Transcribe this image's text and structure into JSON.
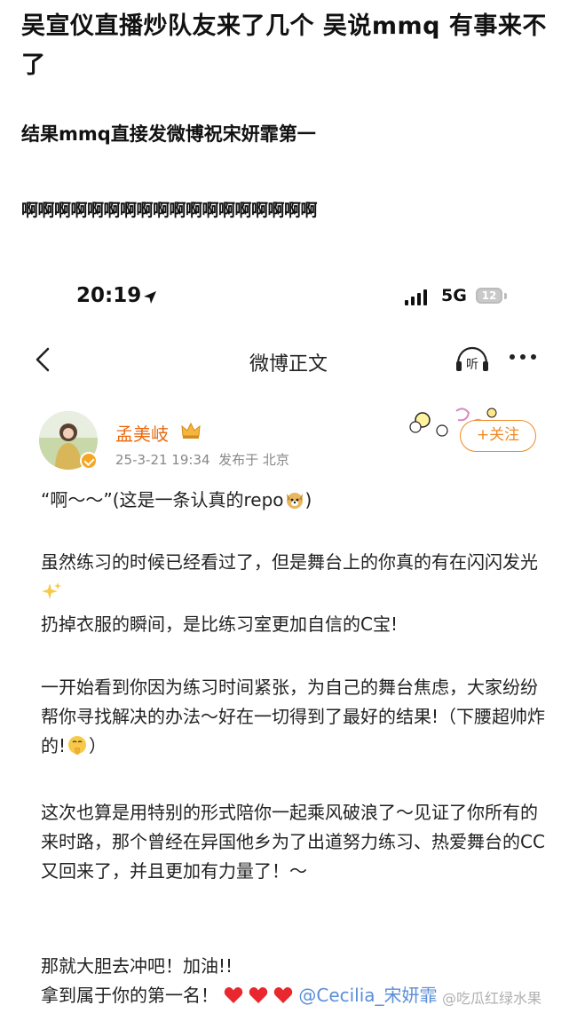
{
  "caption": {
    "title": "吴宣仪直播炒队友来了几个 吴说mmq 有事来不了",
    "line2": "结果mmq直接发微博祝宋妍霏第一",
    "line3": "啊啊啊啊啊啊啊啊啊啊啊啊啊啊啊啊啊啊"
  },
  "status_bar": {
    "time": "20:19",
    "network": "5G",
    "battery": "12"
  },
  "nav": {
    "title": "微博正文",
    "listen_label": "听"
  },
  "post": {
    "username": "孟美岐",
    "date": "25-3-21 19:34",
    "location": "发布于 北京",
    "follow_label": "+关注",
    "p1": "“啊～～”(这是一条认真的repo",
    "p1_end": ")",
    "p2_a": "虽然练习的时候已经看过了，但是舞台上的你真的有在闪闪发光",
    "p2_b": "扔掉衣服的瞬间，是比练习室更加自信的C宝!",
    "p3_a": "一开始看到你因为练习时间紧张，为自己的舞台焦虑，大家纷纷帮你寻找解决的办法～好在一切得到了最好的结果!（下腰超帅炸的!",
    "p3_end": "）",
    "p4": "这次也算是用特别的形式陪你一起乘风破浪了～见证了你所有的来时路，那个曾经在异国他乡为了出道努力练习、热爱舞台的CC又回来了，并且更加有力量了！～",
    "p5_a": "那就大胆去冲吧！加油!!",
    "p5_b": "拿到属于你的第一名！",
    "mention": "@Cecilia_宋妍霏"
  },
  "watermark": "@吃瓜红绿水果",
  "icons": [
    "location-arrow-icon",
    "signal-icon",
    "battery-icon",
    "back-arrow-icon",
    "listen-icon",
    "more-icon",
    "crown-icon",
    "verified-icon",
    "dog-emoji-icon",
    "sparkles-emoji-icon",
    "shush-emoji-icon",
    "heart-icon"
  ],
  "colors": {
    "accent": "#f08a24",
    "username": "#e86a10",
    "mention": "#5a8ed8",
    "heart": "#e8282e"
  }
}
